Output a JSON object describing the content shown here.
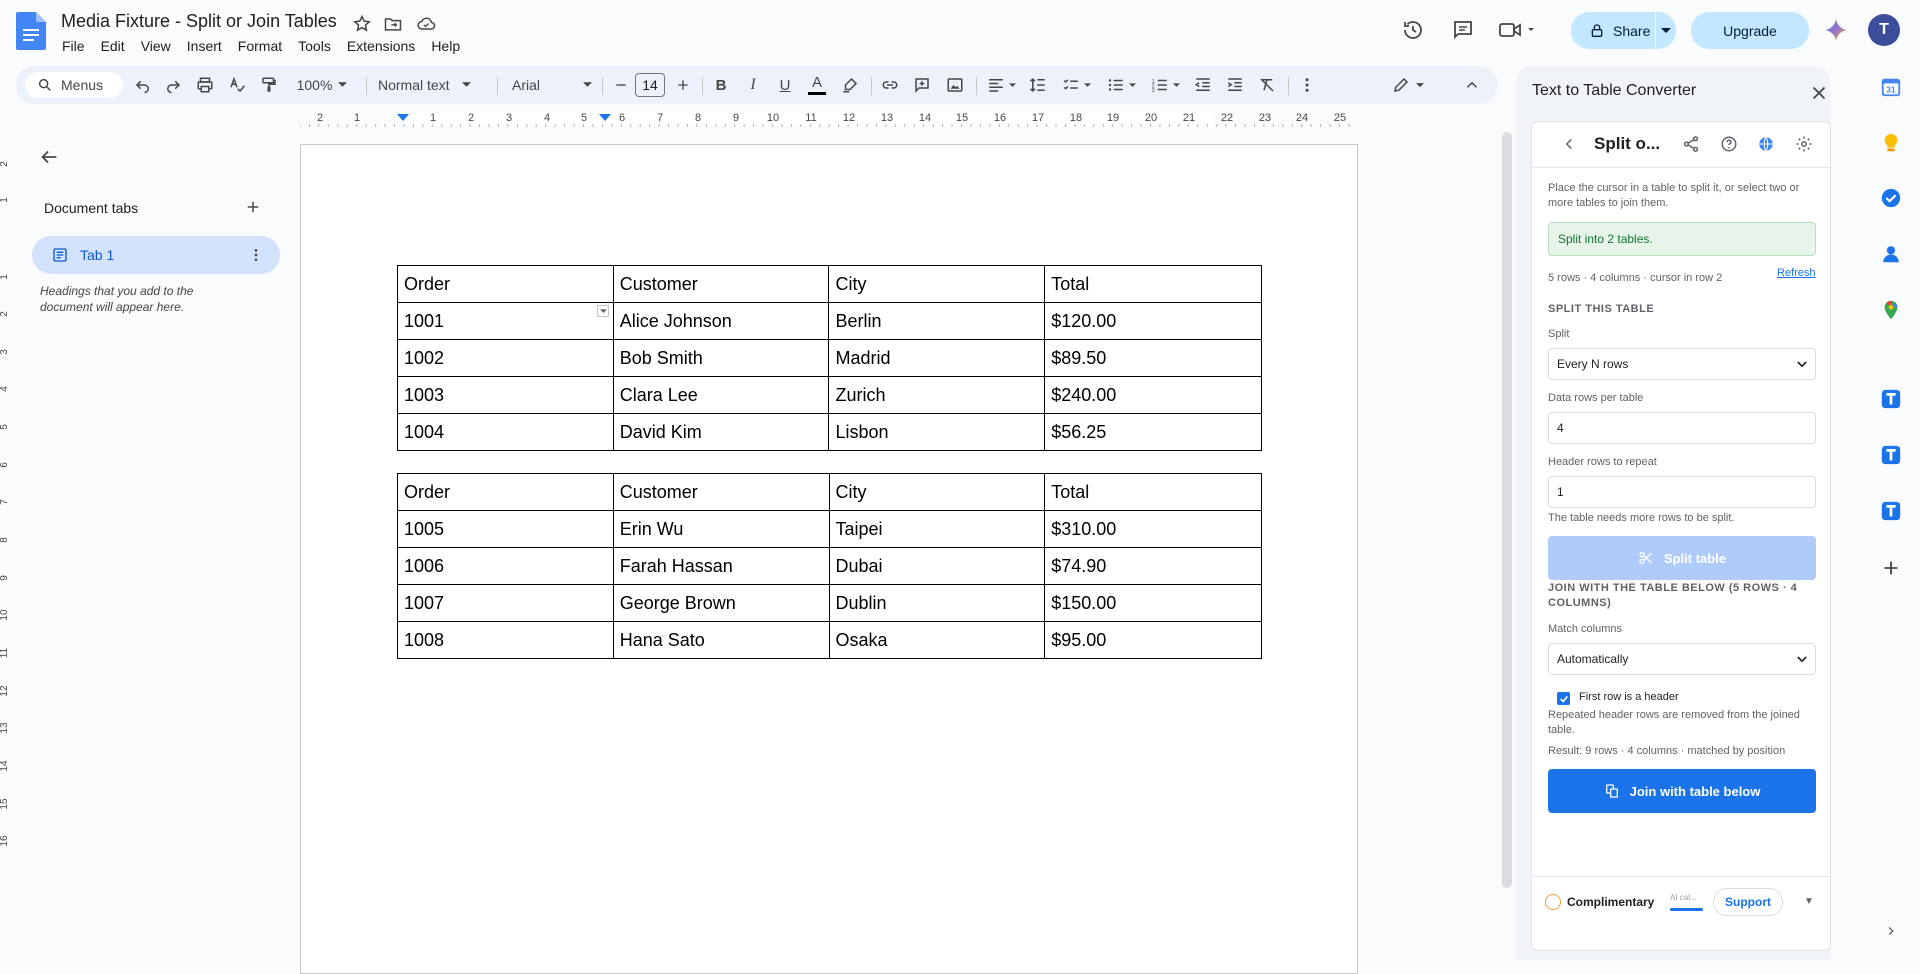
{
  "doc": {
    "title": "Media Fixture - Split or Join Tables",
    "menus": [
      "File",
      "Edit",
      "View",
      "Insert",
      "Format",
      "Tools",
      "Extensions",
      "Help"
    ]
  },
  "header": {
    "share_label": "Share",
    "upgrade_label": "Upgrade",
    "avatar_letter": "T"
  },
  "toolbar": {
    "search_label": "Menus",
    "zoom": "100%",
    "style": "Normal text",
    "font": "Arial",
    "font_size": "14"
  },
  "ruler": {
    "ticks": [
      "2",
      "1",
      "1",
      "2",
      "3",
      "4",
      "5",
      "6",
      "7",
      "8",
      "9",
      "10",
      "11",
      "12",
      "13",
      "14",
      "15",
      "16",
      "17",
      "18",
      "19",
      "20",
      "21",
      "22",
      "23",
      "24",
      "25"
    ]
  },
  "vruler": {
    "ticks": [
      "2",
      "1",
      "1",
      "2",
      "3",
      "4",
      "5",
      "6",
      "7",
      "8",
      "9",
      "10",
      "11",
      "12",
      "13",
      "14",
      "15",
      "16"
    ]
  },
  "outline": {
    "title": "Document tabs",
    "tab_label": "Tab 1",
    "hint": "Headings that you add to the document will appear here."
  },
  "tables": [
    {
      "rows": [
        [
          "Order",
          "Customer",
          "City",
          "Total"
        ],
        [
          "1001",
          "Alice Johnson",
          "Berlin",
          "$120.00"
        ],
        [
          "1002",
          "Bob Smith",
          "Madrid",
          "$89.50"
        ],
        [
          "1003",
          "Clara Lee",
          "Zurich",
          "$240.00"
        ],
        [
          "1004",
          "David Kim",
          "Lisbon",
          "$56.25"
        ]
      ]
    },
    {
      "rows": [
        [
          "Order",
          "Customer",
          "City",
          "Total"
        ],
        [
          "1005",
          "Erin Wu",
          "Taipei",
          "$310.00"
        ],
        [
          "1006",
          "Farah Hassan",
          "Dubai",
          "$74.90"
        ],
        [
          "1007",
          "George Brown",
          "Dublin",
          "$150.00"
        ],
        [
          "1008",
          "Hana Sato",
          "Osaka",
          "$95.00"
        ]
      ]
    }
  ],
  "panel": {
    "title": "Text to Table Converter",
    "addon_title": "Split o...",
    "instructions": "Place the cursor in a table to split it, or select two or more tables to join them.",
    "status": "Split into 2 tables.",
    "meta": "5 rows · 4 columns · cursor in row 2",
    "refresh": "Refresh",
    "split_section": "SPLIT THIS TABLE",
    "split_label": "Split",
    "split_value": "Every N rows",
    "rows_label": "Data rows per table",
    "rows_value": "4",
    "header_label": "Header rows to repeat",
    "header_value": "1",
    "split_note": "The table needs more rows to be split.",
    "split_button": "Split table",
    "join_section": "JOIN WITH THE TABLE BELOW (5 ROWS · 4 COLUMNS)",
    "match_label": "Match columns",
    "match_value": "Automatically",
    "first_row_label": "First row is a header",
    "repeat_note": "Repeated header rows are removed from the joined table.",
    "result": "Result: 9 rows · 4 columns · matched by position",
    "join_button": "Join with table below",
    "plan": "Complimentary",
    "ai": "AI cal...",
    "support": "Support"
  },
  "rail": {
    "calendar_day": "31"
  },
  "colors": {
    "accent": "#1a73e8",
    "share_bg": "#c2e7ff",
    "tab_active": "#d3e3fd",
    "status_green": "#137333"
  }
}
